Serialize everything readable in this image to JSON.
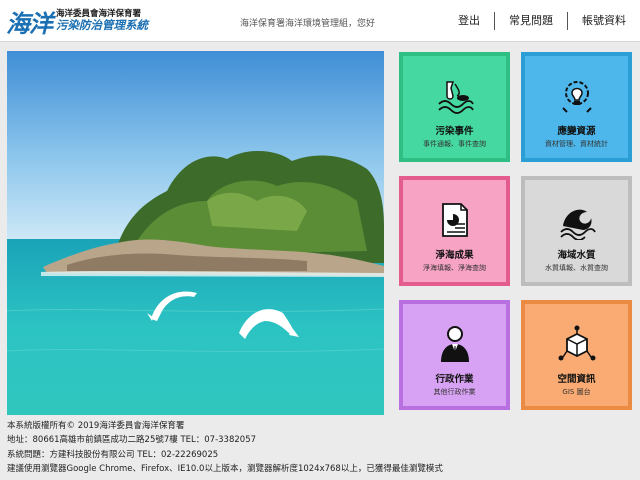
{
  "header": {
    "logo_big": "海洋",
    "logo_org": "海洋委員會海洋保育署",
    "logo_system": "污染防治管理系統",
    "greeting": "海洋保育署海洋環境管理組，您好",
    "nav": [
      "登出",
      "常見問題",
      "帳號資料"
    ]
  },
  "tiles": [
    {
      "title": "污染事件",
      "subtitle": "事件通報、事件查詢",
      "icon": "oil-spill-icon",
      "color": "#45d8a1"
    },
    {
      "title": "應變資源",
      "subtitle": "資材管理、資材統計",
      "icon": "gear-lightbulb-icon",
      "color": "#4db7ec"
    },
    {
      "title": "淨海成果",
      "subtitle": "淨海填報、淨海查詢",
      "icon": "report-document-icon",
      "color": "#f7a3c4"
    },
    {
      "title": "海域水質",
      "subtitle": "水質填報、水質查詢",
      "icon": "wave-water-icon",
      "color": "#d9d9d9"
    },
    {
      "title": "行政作業",
      "subtitle": "其他行政作業",
      "icon": "officer-person-icon",
      "color": "#d7a2f3"
    },
    {
      "title": "空間資訊",
      "subtitle": "GIS 圖台",
      "icon": "network-cube-icon",
      "color": "#f9ab73"
    }
  ],
  "footer": {
    "copyright": "本系統版權所有© 2019海洋委員會海洋保育署",
    "address": "地址：80661高雄市前鎮區成功二路25號7樓 TEL：07-3382057",
    "support": "系統問題：方建科技股份有限公司 TEL：02-22269025",
    "browser": "建議使用瀏覽器Google Chrome、Firefox、IE10.0以上版本，瀏覽器解析度1024x768以上，已獲得最佳瀏覽模式"
  }
}
